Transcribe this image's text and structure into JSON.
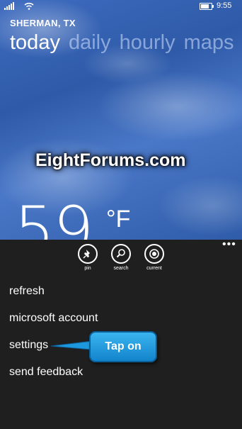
{
  "status_bar": {
    "time": "9:55"
  },
  "location": {
    "city": "SHERMAN, TX"
  },
  "pivots": [
    {
      "label": "today",
      "active": true
    },
    {
      "label": "daily",
      "active": false
    },
    {
      "label": "hourly",
      "active": false
    },
    {
      "label": "maps",
      "active": false
    }
  ],
  "watermark": "EightForums.com",
  "weather": {
    "temperature": "59",
    "unit": "°F"
  },
  "app_bar": {
    "more": "•••",
    "buttons": [
      {
        "icon": "pin-icon",
        "label": "pin"
      },
      {
        "icon": "search-icon",
        "label": "search"
      },
      {
        "icon": "current-location-icon",
        "label": "current"
      }
    ],
    "menu_items": [
      "refresh",
      "microsoft account",
      "settings",
      "send feedback"
    ]
  },
  "callout": {
    "text": "Tap on"
  },
  "colors": {
    "sky": "#3f6cc0",
    "app_bar": "#1f1f1f",
    "callout": "#1e98dc"
  }
}
